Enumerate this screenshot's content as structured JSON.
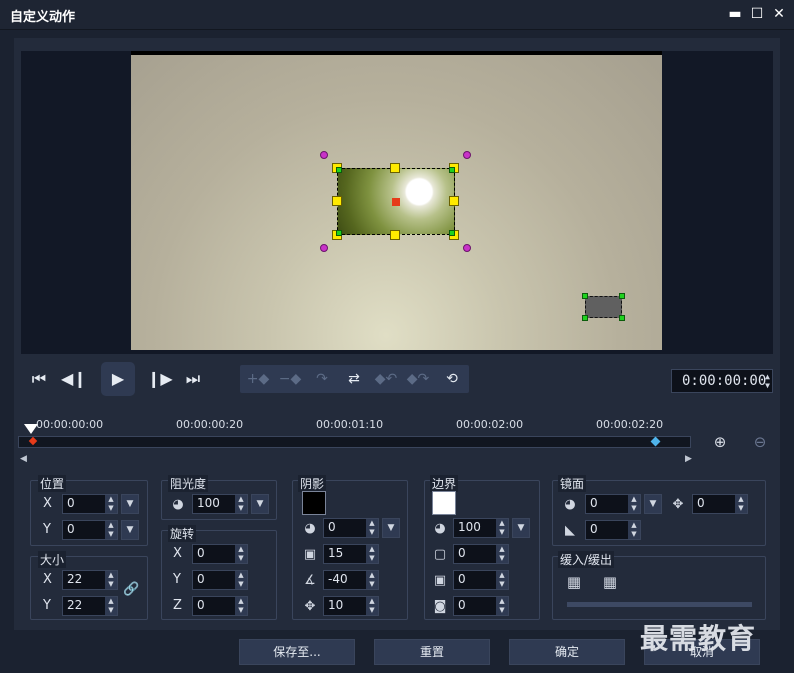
{
  "window": {
    "title": "自定义动作"
  },
  "timecode": "0:00:00:00",
  "ruler": {
    "ticks": [
      "00:00:00:00",
      "00:00:00:20",
      "00:00:01:10",
      "00:00:02:00",
      "00:00:02:20"
    ]
  },
  "position": {
    "title": "位置",
    "x_label": "X",
    "x": "0",
    "y_label": "Y",
    "y": "0"
  },
  "size": {
    "title": "大小",
    "x_label": "X",
    "x": "22",
    "y_label": "Y",
    "y": "22"
  },
  "opacity": {
    "title": "阻光度",
    "value": "100"
  },
  "rotation": {
    "title": "旋转",
    "x_label": "X",
    "x": "0",
    "y_label": "Y",
    "y": "0",
    "z_label": "Z",
    "z": "0"
  },
  "shadow": {
    "title": "阴影",
    "opacity": "0",
    "blur": "15",
    "angle": "-40",
    "distance": "10"
  },
  "border": {
    "title": "边界",
    "opacity": "100",
    "width": "0",
    "soft1": "0",
    "soft2": "0"
  },
  "mirror": {
    "title": "镜面",
    "opacity": "0",
    "offset": "0",
    "fade": "0"
  },
  "ease": {
    "title": "缓入/缓出"
  },
  "footer": {
    "save_label": "保存至...",
    "reset_label": "重置",
    "ok_label": "确定",
    "cancel_label": "取消"
  },
  "watermark": "最需教育"
}
